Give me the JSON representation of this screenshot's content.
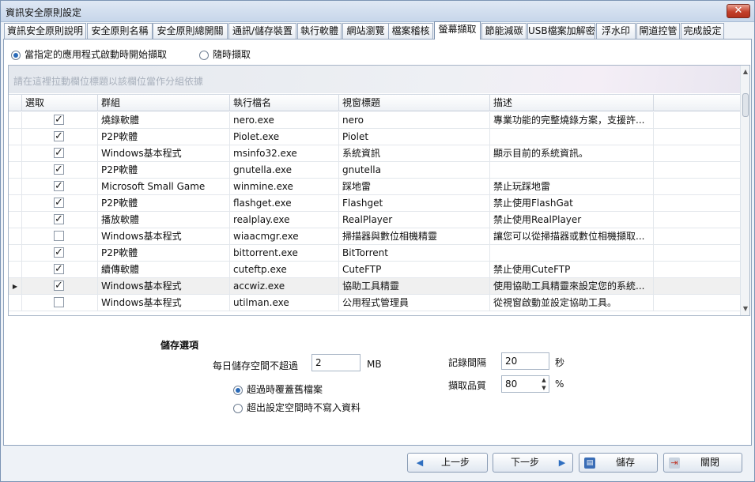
{
  "window": {
    "title": "資訊安全原則設定",
    "close_symbol": "✕"
  },
  "tabs": [
    {
      "label": "資訊安全原則說明"
    },
    {
      "label": "安全原則名稱"
    },
    {
      "label": "安全原則總開關"
    },
    {
      "label": "通訊/儲存裝置"
    },
    {
      "label": "執行軟體"
    },
    {
      "label": "網站瀏覽"
    },
    {
      "label": "檔案稽核"
    },
    {
      "label": "螢幕擷取"
    },
    {
      "label": "節能減碳"
    },
    {
      "label": "USB檔案加解密"
    },
    {
      "label": "浮水印"
    },
    {
      "label": "閘道控管"
    },
    {
      "label": "完成設定"
    }
  ],
  "active_tab": "螢幕擷取",
  "capture_mode": {
    "option_app": "當指定的應用程式啟動時開始擷取",
    "option_anytime": "隨時擷取",
    "selected": "option_app"
  },
  "grid": {
    "group_hint": "請在這裡拉動欄位標題以該欄位當作分組依據",
    "headers": {
      "select": "選取",
      "group": "群組",
      "exe": "執行檔名",
      "window": "視窗標題",
      "desc": "描述"
    },
    "rows": [
      {
        "checked": true,
        "group": "燒錄軟體",
        "exe": "nero.exe",
        "window": "nero",
        "desc": "專業功能的完整燒錄方案，支援許..."
      },
      {
        "checked": true,
        "group": "P2P軟體",
        "exe": "Piolet.exe",
        "window": "Piolet",
        "desc": ""
      },
      {
        "checked": true,
        "group": "Windows基本程式",
        "exe": "msinfo32.exe",
        "window": "系統資訊",
        "desc": "顯示目前的系統資訊。"
      },
      {
        "checked": true,
        "group": "P2P軟體",
        "exe": "gnutella.exe",
        "window": "gnutella",
        "desc": ""
      },
      {
        "checked": true,
        "group": "Microsoft Small Game",
        "exe": "winmine.exe",
        "window": "踩地雷",
        "desc": "禁止玩踩地雷"
      },
      {
        "checked": true,
        "group": "P2P軟體",
        "exe": "flashget.exe",
        "window": "Flashget",
        "desc": "禁止使用FlashGat"
      },
      {
        "checked": true,
        "group": "播放軟體",
        "exe": "realplay.exe",
        "window": "RealPlayer",
        "desc": "禁止使用RealPlayer"
      },
      {
        "checked": false,
        "group": "Windows基本程式",
        "exe": "wiaacmgr.exe",
        "window": "掃描器與數位相機精靈",
        "desc": "讓您可以從掃描器或數位相機擷取..."
      },
      {
        "checked": true,
        "group": "P2P軟體",
        "exe": "bittorrent.exe",
        "window": "BitTorrent",
        "desc": ""
      },
      {
        "checked": true,
        "group": "續傳軟體",
        "exe": "cuteftp.exe",
        "window": "CuteFTP",
        "desc": "禁止使用CuteFTP"
      },
      {
        "checked": true,
        "group": "Windows基本程式",
        "exe": "accwiz.exe",
        "window": "協助工具精靈",
        "desc": "使用協助工具精靈來設定您的系統...",
        "current": true
      },
      {
        "checked": false,
        "group": "Windows基本程式",
        "exe": "utilman.exe",
        "window": "公用程式管理員",
        "desc": "從視窗啟動並設定協助工具。"
      }
    ]
  },
  "storage": {
    "section_title": "儲存選項",
    "daily_limit_label": "每日儲存空間不超過",
    "daily_limit_value": "2",
    "daily_limit_unit": "MB",
    "overwrite_label": "超過時覆蓋舊檔案",
    "no_write_label": "超出設定空間時不寫入資料",
    "overflow_selected": "overwrite",
    "interval_label": "記錄間隔",
    "interval_value": "20",
    "interval_unit": "秒",
    "quality_label": "擷取品質",
    "quality_value": "80",
    "quality_unit": "%"
  },
  "buttons": {
    "prev": "上一步",
    "next": "下一步",
    "save": "儲存",
    "close": "關閉"
  }
}
